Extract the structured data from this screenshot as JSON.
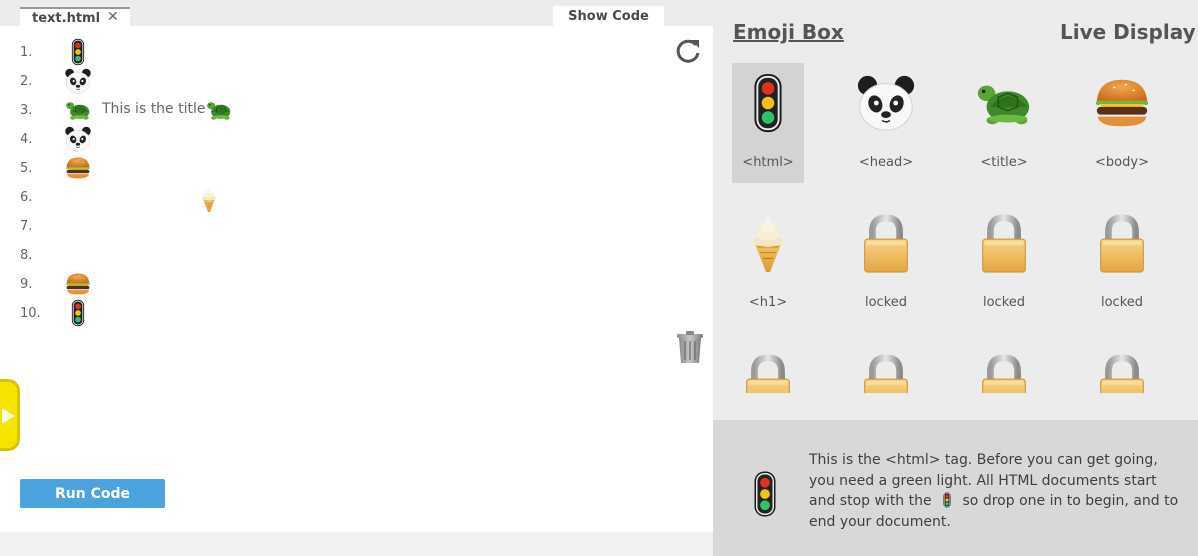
{
  "editor": {
    "tab_label": "text.html",
    "tab_close": "✕",
    "show_code_label": "Show Code",
    "run_label": "Run Code",
    "lines": [
      {
        "number": "1.",
        "tokens": [
          "traffic-light"
        ]
      },
      {
        "number": "2.",
        "tokens": [
          "panda"
        ]
      },
      {
        "number": "3.",
        "tokens": [
          "turtle",
          "turtle"
        ],
        "text": "This is the title"
      },
      {
        "number": "4.",
        "tokens": [
          "panda"
        ]
      },
      {
        "number": "5.",
        "tokens": [
          "burger"
        ]
      },
      {
        "number": "6.",
        "tokens": [
          "ice-cream"
        ]
      },
      {
        "number": "7.",
        "tokens": []
      },
      {
        "number": "8.",
        "tokens": []
      },
      {
        "number": "9.",
        "tokens": [
          "burger"
        ]
      },
      {
        "number": "10.",
        "tokens": [
          "traffic-light"
        ]
      }
    ]
  },
  "emoji_box": {
    "title": "Emoji Box",
    "live_display": "Live Display",
    "items": [
      {
        "icon": "traffic-light",
        "label": "<html>",
        "selected": true
      },
      {
        "icon": "panda",
        "label": "<head>"
      },
      {
        "icon": "turtle",
        "label": "<title>"
      },
      {
        "icon": "burger",
        "label": "<body>"
      },
      {
        "icon": "ice-cream",
        "label": "<h1>"
      },
      {
        "icon": "lock",
        "label": "locked"
      },
      {
        "icon": "lock",
        "label": "locked"
      },
      {
        "icon": "lock",
        "label": "locked"
      },
      {
        "icon": "lock",
        "label": ""
      },
      {
        "icon": "lock",
        "label": ""
      },
      {
        "icon": "lock",
        "label": ""
      },
      {
        "icon": "lock",
        "label": ""
      }
    ]
  },
  "info": {
    "text_before": "This is the <html> tag. Before you can get going, you need a green light. All HTML documents start and stop with the",
    "text_after": "so drop one in to begin, and to end your document."
  },
  "colors": {
    "accent": "#4aa3df",
    "handle": "#f4e400"
  }
}
